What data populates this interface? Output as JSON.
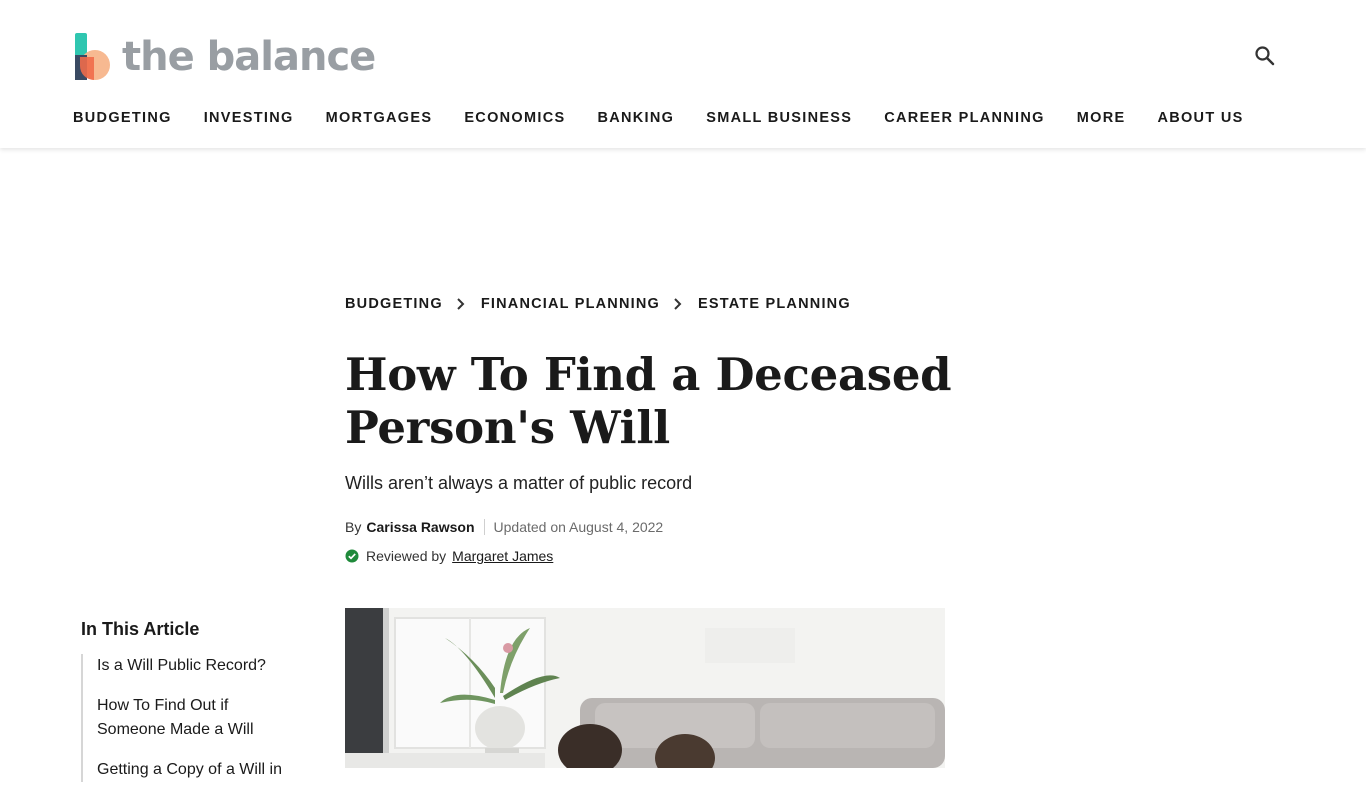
{
  "header": {
    "logo_text": "the balance",
    "nav": [
      "BUDGETING",
      "INVESTING",
      "MORTGAGES",
      "ECONOMICS",
      "BANKING",
      "SMALL BUSINESS",
      "CAREER PLANNING",
      "MORE",
      "ABOUT US"
    ],
    "search_icon": "search-icon"
  },
  "breadcrumb": [
    "BUDGETING",
    "FINANCIAL PLANNING",
    "ESTATE PLANNING"
  ],
  "article": {
    "title": "How To Find a Deceased Person's Will",
    "subtitle": "Wills aren’t always a matter of public record",
    "by_label": "By",
    "author": "Carissa Rawson",
    "updated": "Updated on August 4, 2022",
    "reviewed_label": "Reviewed by",
    "reviewer": "Margaret James"
  },
  "toc": {
    "title": "In This Article",
    "items": [
      "Is a Will Public Record?",
      "How To Find Out if Someone Made a Will",
      "Getting a Copy of a Will in"
    ]
  },
  "hero_image": {
    "description_icon": "photo"
  },
  "colors": {
    "logo_gray": "#999ea3",
    "logo_teal": "#2fc6b0",
    "logo_peach": "#f7b58b",
    "logo_coral": "#ef6b4a",
    "verified_green": "#1f8a3b",
    "text": "#1a1a1a"
  }
}
